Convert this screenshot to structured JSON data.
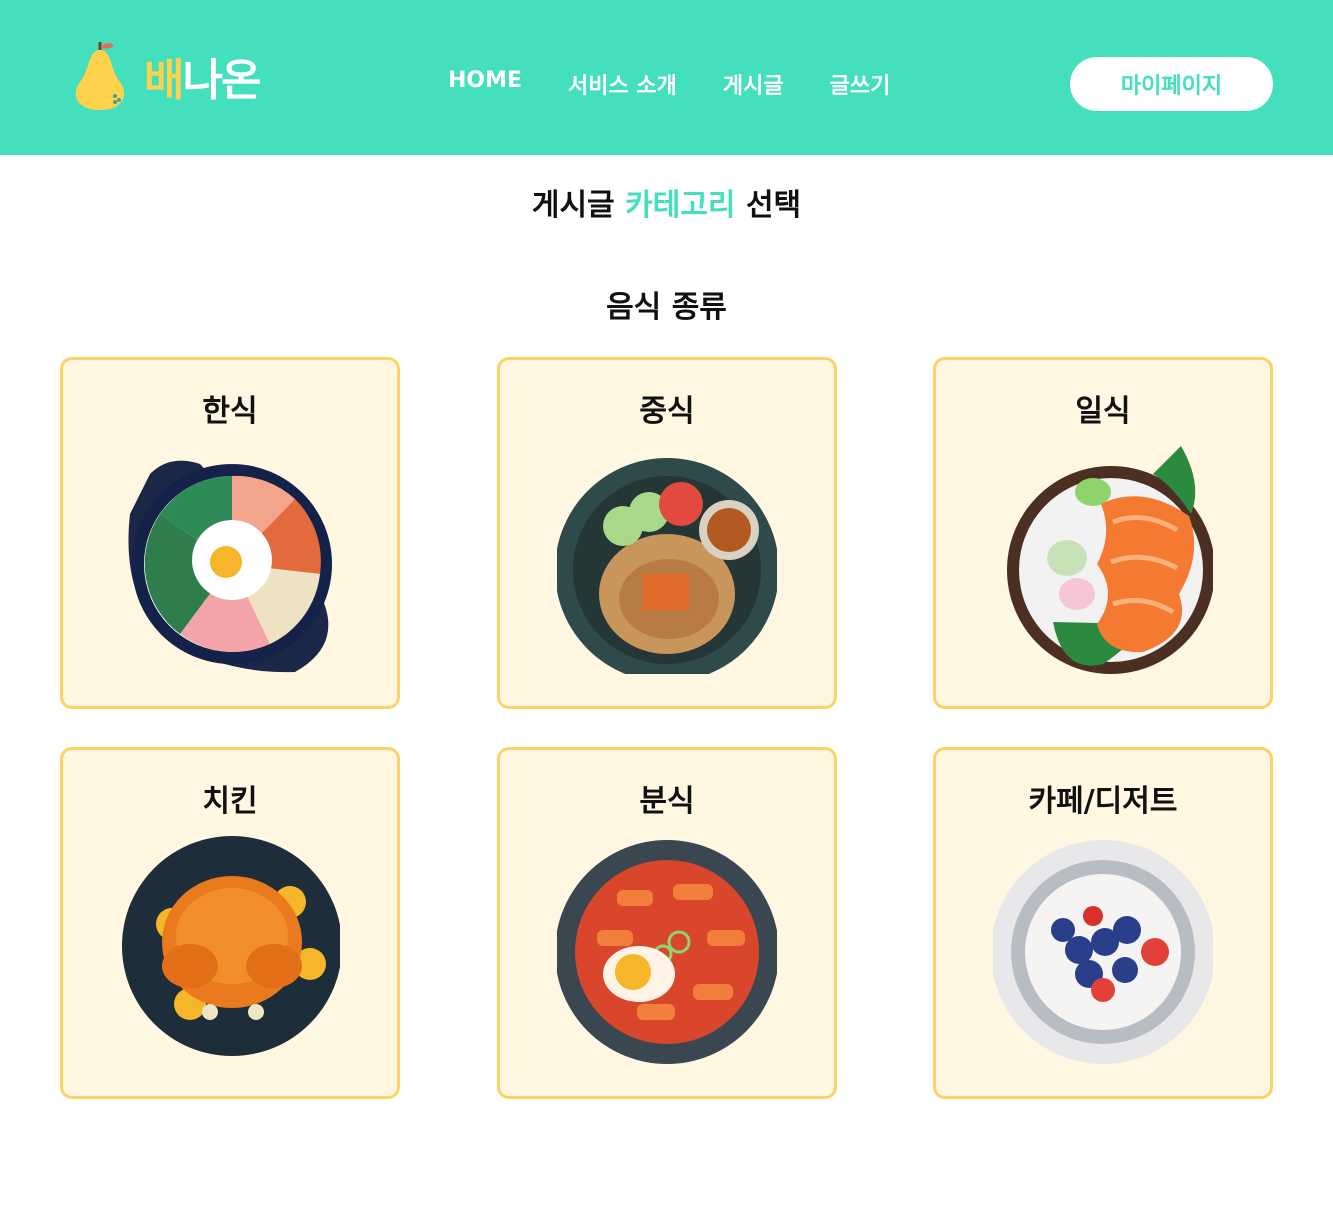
{
  "header": {
    "logo": {
      "text_pre": "배",
      "text_post": "나온",
      "icon": "pear-icon"
    },
    "nav": [
      {
        "label": "HOME"
      },
      {
        "label": "서비스 소개"
      },
      {
        "label": "게시글"
      },
      {
        "label": "글쓰기"
      }
    ],
    "mypage_label": "마이페이지"
  },
  "page_title": {
    "pre": "게시글 ",
    "accent": "카테고리",
    "post": " 선택"
  },
  "section_title": "음식 종류",
  "categories": [
    {
      "label": "한식",
      "icon": "bibimbap-icon"
    },
    {
      "label": "중식",
      "icon": "fried-rice-icon"
    },
    {
      "label": "일식",
      "icon": "salmon-sashimi-icon"
    },
    {
      "label": "치킨",
      "icon": "roast-chicken-icon"
    },
    {
      "label": "분식",
      "icon": "tteokbokki-icon"
    },
    {
      "label": "카페/디저트",
      "icon": "berry-dessert-icon"
    }
  ],
  "colors": {
    "brand": "#44dfbc",
    "card_bg": "#fff7e1",
    "card_border": "#ffd265",
    "logo_yellow": "#ffd24d"
  }
}
